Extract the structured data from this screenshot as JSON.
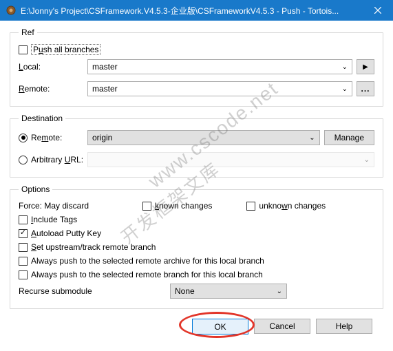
{
  "title": "E:\\Jonny's Project\\CSFramework.V4.5.3-企业版\\CSFrameworkV4.5.3 - Push - Tortois...",
  "ref": {
    "legend": "Ref",
    "push_all": "Push all branches",
    "local_label": "Local:",
    "local_value": "master",
    "remote_label": "Remote:",
    "remote_value": "master",
    "browse": "..."
  },
  "dest": {
    "legend": "Destination",
    "remote_label": "Remote:",
    "remote_value": "origin",
    "manage": "Manage",
    "arb_label": "Arbitrary URL:"
  },
  "opts": {
    "legend": "Options",
    "force_label": "Force: May discard",
    "known": "known changes",
    "unknown": "unknown changes",
    "include_tags": "Include Tags",
    "autoload": "Autoload Putty Key",
    "setupstream": "Set upstream/track remote branch",
    "always_archive": "Always push to the selected remote archive for this local branch",
    "always_branch": "Always push to the selected remote branch for this local branch",
    "recurse_label": "Recurse submodule",
    "recurse_value": "None"
  },
  "footer": {
    "ok": "OK",
    "cancel": "Cancel",
    "help": "Help"
  },
  "watermark1": "www.cscode.net",
  "watermark2": "开发框架文库"
}
